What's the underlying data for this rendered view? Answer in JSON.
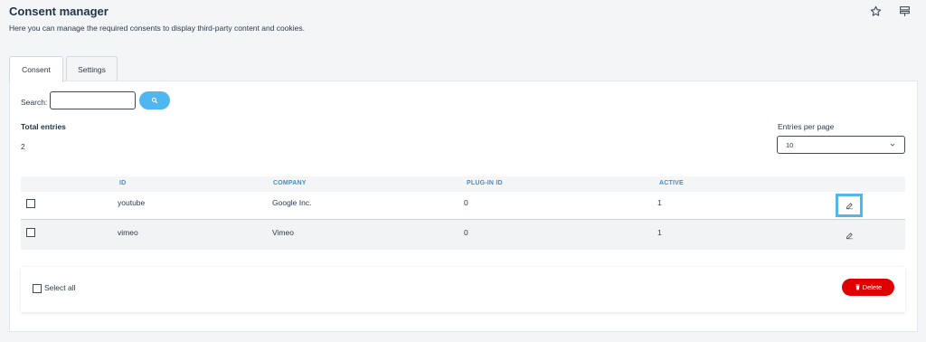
{
  "header": {
    "title": "Consent manager",
    "description": "Here you can manage the required consents to display third-party content and cookies.",
    "icons": [
      "star-icon",
      "sliders-icon"
    ]
  },
  "tabs": [
    {
      "label": "Consent",
      "active": true
    },
    {
      "label": "Settings",
      "active": false
    }
  ],
  "search": {
    "label": "Search:",
    "value": "",
    "placeholder": "",
    "button_icon": "search-icon"
  },
  "summary": {
    "total_label": "Total entries",
    "total_value": "2"
  },
  "entries_per_page": {
    "label": "Entries per page",
    "selected": "10"
  },
  "table": {
    "columns": [
      "ID",
      "COMPANY",
      "PLUG-IN ID",
      "ACTIVE"
    ],
    "rows": [
      {
        "id": "youtube",
        "company": "Google Inc.",
        "plugin_id": "0",
        "active": "1"
      },
      {
        "id": "vimeo",
        "company": "Vimeo",
        "plugin_id": "0",
        "active": "1"
      }
    ]
  },
  "footer": {
    "select_all_label": "Select all",
    "delete_label": "Delete"
  },
  "colors": {
    "accent": "#4fb6ef",
    "header_text": "#3a8fd0",
    "danger": "#e00000"
  }
}
